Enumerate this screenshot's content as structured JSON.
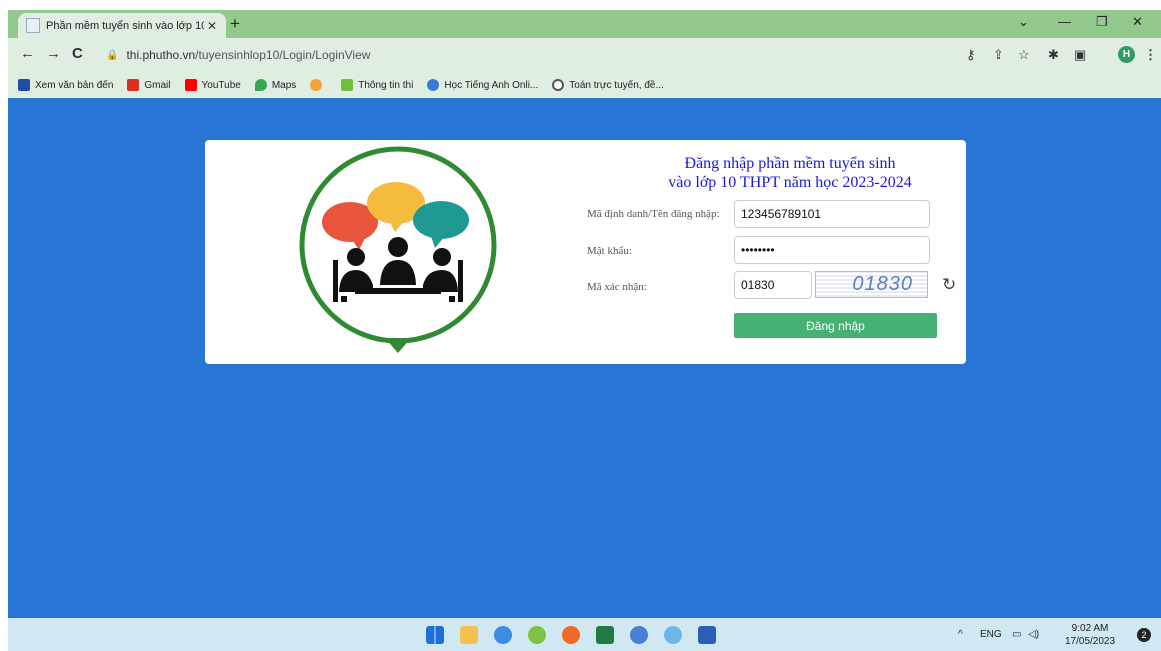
{
  "browser": {
    "tab_title": "Phần mềm tuyển sinh vào lớp 10",
    "tab_close": "✕",
    "new_tab": "+",
    "url_host": "thi.phutho.vn",
    "url_path": "/tuyensinhlop10/Login/LoginView",
    "profile_initial": "H",
    "bookmarks": [
      {
        "label": "Xem văn bản đến",
        "color": "#1f4fa0"
      },
      {
        "label": "Gmail",
        "color": "#d93025"
      },
      {
        "label": "YouTube",
        "color": "#ff0000"
      },
      {
        "label": "Maps",
        "color": "#34a853"
      },
      {
        "label": "",
        "color": "#f2a33a"
      },
      {
        "label": "Thông tin thi",
        "color": "#6fbf3f"
      },
      {
        "label": "Học Tiếng Anh Onli...",
        "color": "#3a7bd5"
      },
      {
        "label": "Toán trực tuyến, đề...",
        "color": "#555555"
      }
    ]
  },
  "login": {
    "heading_line1": "Đăng nhập phần mềm tuyển sinh",
    "heading_line2": "vào lớp 10 THPT năm học 2023-2024",
    "username_label": "Mã định danh/Tên đăng nhập:",
    "username_value": "123456789101",
    "password_label": "Mật khẩu:",
    "password_value": "••••••••",
    "captcha_label": "Mã xác nhận:",
    "captcha_value": "01830",
    "captcha_image_text": "01830",
    "submit_label": "Đăng nhập",
    "colors": {
      "page_bg": "#2775d4",
      "button": "#46b174",
      "heading": "#1a1ad6",
      "logo_ring": "#2f8a34"
    }
  },
  "taskbar": {
    "lang": "ENG",
    "time": "9:02 AM",
    "date": "17/05/2023",
    "notifications": "2"
  }
}
